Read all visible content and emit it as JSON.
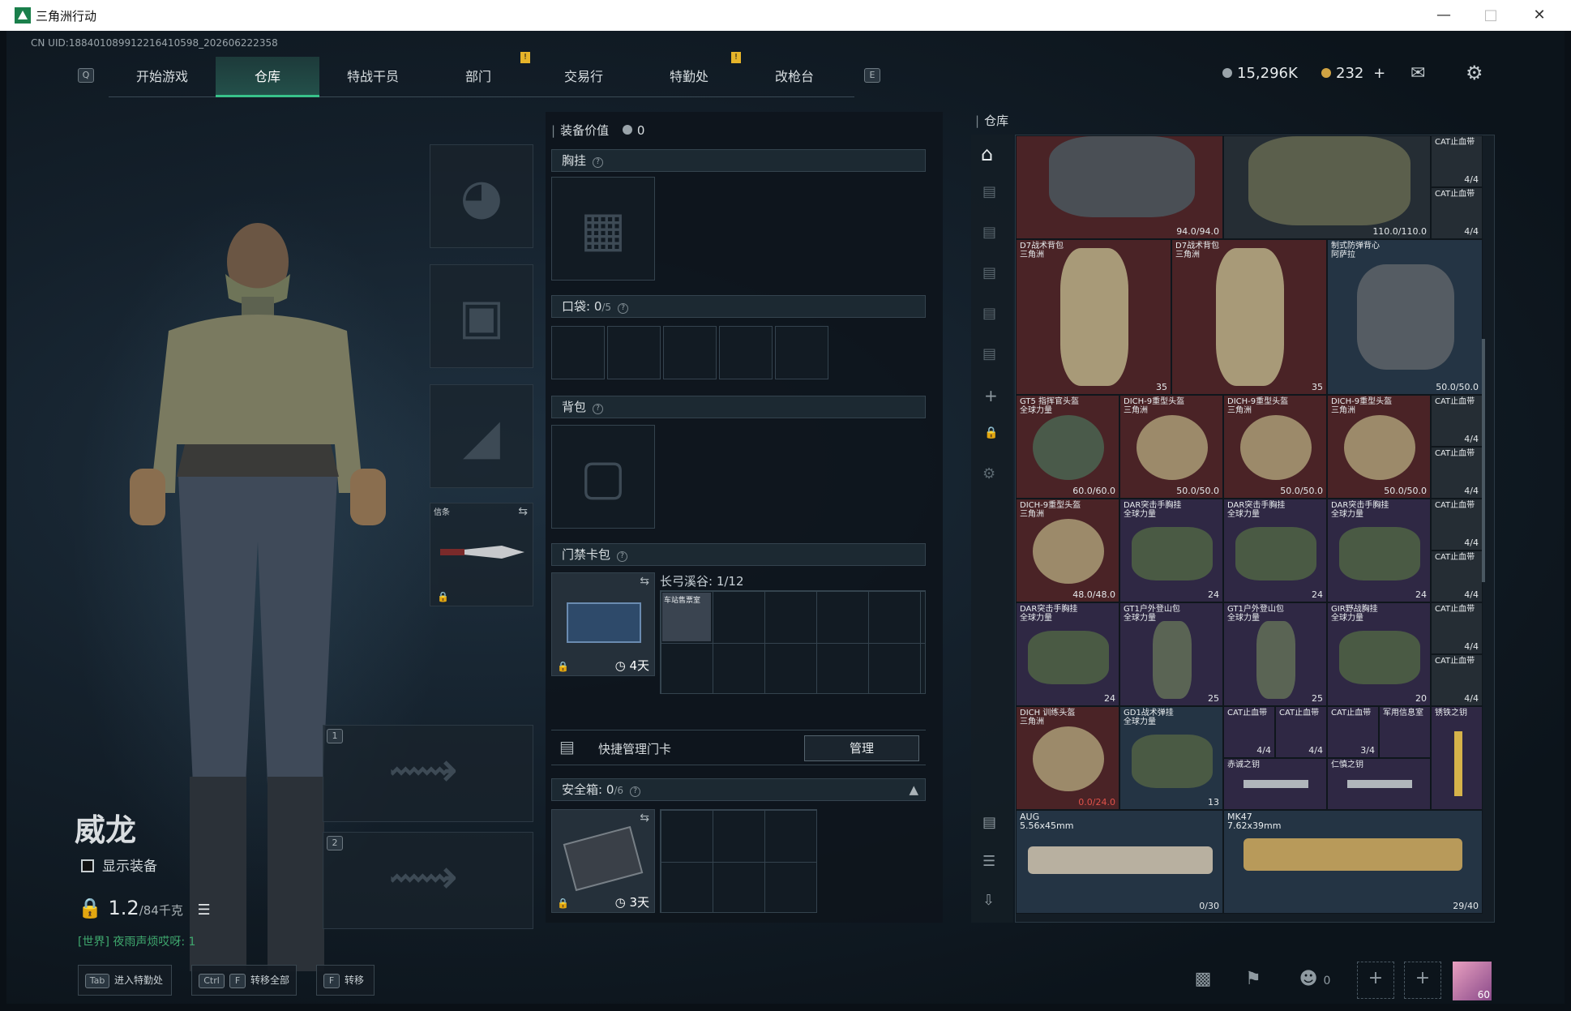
{
  "window": {
    "title": "三角洲行动"
  },
  "uid": "CN UID:188401089912216410598_202606222358",
  "tabs": [
    {
      "label": "开始游戏"
    },
    {
      "label": "仓库"
    },
    {
      "label": "特战干员"
    },
    {
      "label": "部门"
    },
    {
      "label": "交易行"
    },
    {
      "label": "特勤处"
    },
    {
      "label": "改枪台"
    }
  ],
  "tab_keys": {
    "left": "Q",
    "right": "E"
  },
  "currency": {
    "silver": "15,296K",
    "gold": "232",
    "plus": "+"
  },
  "character": {
    "name": "威龙",
    "show_equip_label": "显示装备",
    "weight_value": "1.2",
    "weight_max": "/84千克",
    "chat": "[世界] 夜雨声烦哎呀: 1"
  },
  "equip_slots": {
    "melee_label": "信条",
    "slot1": "1",
    "slot2": "2"
  },
  "middle": {
    "value_label": "装备价值",
    "value": "0",
    "chest_label": "胸挂",
    "pockets_label": "口袋:",
    "pockets_count": "0",
    "pockets_max": "/5",
    "backpack_label": "背包",
    "keycard_label": "门禁卡包",
    "keycard_days": "4天",
    "keycard_location": "长弓溪谷: 1/12",
    "keycard_item": "车站售票室",
    "quick_manage_label": "快捷管理门卡",
    "manage_button": "管理",
    "safebox_label": "安全箱:",
    "safebox_count": "0",
    "safebox_max": "/6",
    "safebox_days": "3天"
  },
  "warehouse": {
    "title": "仓库",
    "items": [
      {
        "name": "",
        "count": "94.0/94.0",
        "color": "red"
      },
      {
        "name": "",
        "count": "110.0/110.0",
        "color": "gray"
      },
      {
        "name": "CAT止血带",
        "count": "4/4",
        "color": "gray"
      },
      {
        "name": "CAT止血带",
        "count": "4/4",
        "color": "gray"
      },
      {
        "name": "D7战术背包\n三角洲",
        "count": "35",
        "color": "red"
      },
      {
        "name": "D7战术背包\n三角洲",
        "count": "35",
        "color": "red"
      },
      {
        "name": "制式防弹背心\n阿萨拉",
        "count": "50.0/50.0",
        "color": "blue"
      },
      {
        "name": "GT5 指挥官头盔\n全球力量",
        "count": "60.0/60.0",
        "color": "red"
      },
      {
        "name": "DICH-9重型头盔\n三角洲",
        "count": "50.0/50.0",
        "color": "red"
      },
      {
        "name": "DICH-9重型头盔\n三角洲",
        "count": "50.0/50.0",
        "color": "red"
      },
      {
        "name": "DICH-9重型头盔\n三角洲",
        "count": "50.0/50.0",
        "color": "red"
      },
      {
        "name": "CAT止血带",
        "count": "4/4",
        "color": "gray"
      },
      {
        "name": "CAT止血带",
        "count": "4/4",
        "color": "gray"
      },
      {
        "name": "DICH-9重型头盔\n三角洲",
        "count": "48.0/48.0",
        "color": "red"
      },
      {
        "name": "DAR突击手胸挂\n全球力量",
        "count": "24",
        "color": "purple"
      },
      {
        "name": "DAR突击手胸挂\n全球力量",
        "count": "24",
        "color": "purple"
      },
      {
        "name": "DAR突击手胸挂\n全球力量",
        "count": "24",
        "color": "purple"
      },
      {
        "name": "CAT止血带",
        "count": "4/4",
        "color": "gray"
      },
      {
        "name": "CAT止血带",
        "count": "4/4",
        "color": "gray"
      },
      {
        "name": "DAR突击手胸挂\n全球力量",
        "count": "24",
        "color": "purple"
      },
      {
        "name": "GT1户外登山包\n全球力量",
        "count": "25",
        "color": "purple"
      },
      {
        "name": "GT1户外登山包\n全球力量",
        "count": "25",
        "color": "purple"
      },
      {
        "name": "GIR野战胸挂\n全球力量",
        "count": "20",
        "color": "purple"
      },
      {
        "name": "CAT止血带",
        "count": "4/4",
        "color": "gray"
      },
      {
        "name": "CAT止血带",
        "count": "4/4",
        "color": "gray"
      },
      {
        "name": "DICH 训练头盔\n三角洲",
        "count": "0.0/24.0",
        "color": "red"
      },
      {
        "name": "GD1战术弹挂\n全球力量",
        "count": "13",
        "color": "blue"
      },
      {
        "name": "CAT止血带",
        "count": "4/4",
        "color": "purple"
      },
      {
        "name": "CAT止血带",
        "count": "4/4",
        "color": "purple"
      },
      {
        "name": "CAT止血带",
        "count": "3/4",
        "color": "purple"
      },
      {
        "name": "军用信息室",
        "count": "",
        "color": "purple"
      },
      {
        "name": "赤诚之钥",
        "count": "",
        "color": "purple"
      },
      {
        "name": "仁慎之钥",
        "count": "",
        "color": "purple"
      },
      {
        "name": "锈铁之钥",
        "count": "",
        "color": "purple"
      },
      {
        "name": "AUG\n5.56x45mm",
        "count": "0/30",
        "color": "blue"
      },
      {
        "name": "MK47\n7.62x39mm",
        "count": "29/40",
        "color": "blue"
      }
    ]
  },
  "bottom": {
    "btn1_key": "Tab",
    "btn1_label": "进入特勤处",
    "btn2_key": "Ctrl",
    "btn2_key2": "F",
    "btn2_label": "转移全部",
    "btn3_key": "F",
    "btn3_label": "转移",
    "squad_count": "0",
    "level": "60"
  }
}
